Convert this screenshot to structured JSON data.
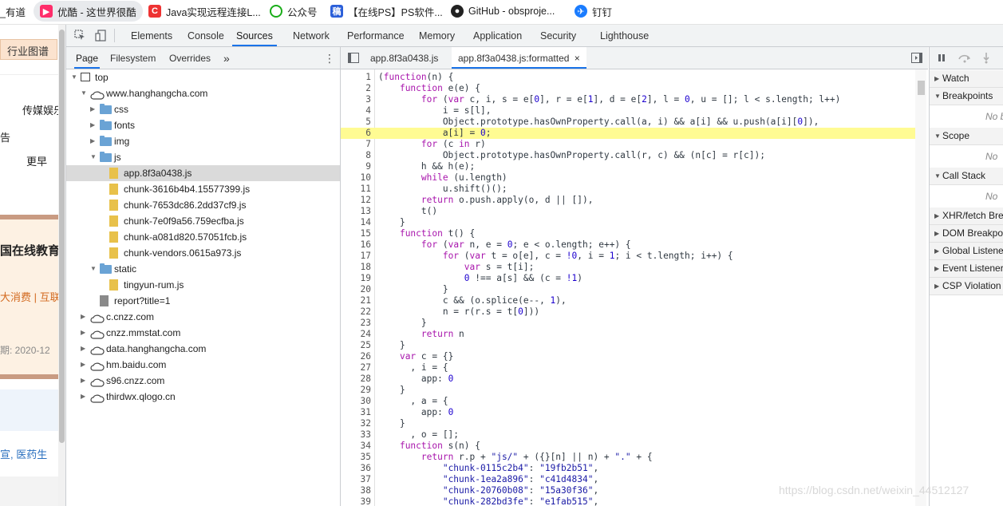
{
  "bookmarks": [
    {
      "label": "_有道",
      "icon": "youdao-icon"
    },
    {
      "label": "优酷 - 这世界很酷",
      "icon": "youku-icon"
    },
    {
      "label": "Java实现远程连接L...",
      "icon": "csdn-icon"
    },
    {
      "label": "公众号",
      "icon": "wechat-icon"
    },
    {
      "label": "【在线PS】PS软件...",
      "icon": "ps-icon"
    },
    {
      "label": "GitHub - obsproje...",
      "icon": "github-icon"
    },
    {
      "label": "钉钉",
      "icon": "dingtalk-icon"
    }
  ],
  "page_fragment": {
    "button": "行业图谱",
    "texts": [
      "传媒娱乐",
      "告",
      "更早",
      "国在线教育",
      "大消费 | 互联",
      "期: 2020-12",
      "宣, 医药生"
    ]
  },
  "devtools": {
    "tabs": [
      "Elements",
      "Console",
      "Sources",
      "Network",
      "Performance",
      "Memory",
      "Application",
      "Security",
      "Lighthouse"
    ],
    "active_tab": "Sources",
    "navigator": {
      "tabs": [
        "Page",
        "Filesystem",
        "Overrides"
      ],
      "more": "»",
      "tree": [
        {
          "label": "top",
          "kind": "frame",
          "level": 0,
          "expanded": true
        },
        {
          "label": "www.hanghangcha.com",
          "kind": "cloud",
          "level": 1,
          "expanded": true
        },
        {
          "label": "css",
          "kind": "folder",
          "level": 2,
          "expanded": false
        },
        {
          "label": "fonts",
          "kind": "folder",
          "level": 2,
          "expanded": false
        },
        {
          "label": "img",
          "kind": "folder",
          "level": 2,
          "expanded": false
        },
        {
          "label": "js",
          "kind": "folder",
          "level": 2,
          "expanded": true
        },
        {
          "label": "app.8f3a0438.js",
          "kind": "file",
          "level": 3,
          "selected": true
        },
        {
          "label": "chunk-3616b4b4.15577399.js",
          "kind": "file",
          "level": 3
        },
        {
          "label": "chunk-7653dc86.2dd37cf9.js",
          "kind": "file",
          "level": 3
        },
        {
          "label": "chunk-7e0f9a56.759ecfba.js",
          "kind": "file",
          "level": 3
        },
        {
          "label": "chunk-a081d820.57051fcb.js",
          "kind": "file",
          "level": 3
        },
        {
          "label": "chunk-vendors.0615a973.js",
          "kind": "file",
          "level": 3
        },
        {
          "label": "static",
          "kind": "folder",
          "level": 2,
          "expanded": true
        },
        {
          "label": "tingyun-rum.js",
          "kind": "file",
          "level": 3
        },
        {
          "label": "report?title=1",
          "kind": "gray-file",
          "level": 2
        },
        {
          "label": "c.cnzz.com",
          "kind": "cloud",
          "level": 1,
          "expanded": false
        },
        {
          "label": "cnzz.mmstat.com",
          "kind": "cloud",
          "level": 1,
          "expanded": false
        },
        {
          "label": "data.hanghangcha.com",
          "kind": "cloud",
          "level": 1,
          "expanded": false
        },
        {
          "label": "hm.baidu.com",
          "kind": "cloud",
          "level": 1,
          "expanded": false
        },
        {
          "label": "s96.cnzz.com",
          "kind": "cloud",
          "level": 1,
          "expanded": false
        },
        {
          "label": "thirdwx.qlogo.cn",
          "kind": "cloud",
          "level": 1,
          "expanded": false
        }
      ]
    },
    "editor": {
      "tabs": [
        {
          "label": "app.8f3a0438.js",
          "active": false
        },
        {
          "label": "app.8f3a0438.js:formatted",
          "active": true,
          "close": "×"
        }
      ],
      "highlight_line": 6,
      "lines": [
        "(function(n) {",
        "    function e(e) {",
        "        for (var c, i, s = e[0], r = e[1], d = e[2], l = 0, u = []; l < s.length; l++)",
        "            i = s[l],",
        "            Object.prototype.hasOwnProperty.call(a, i) && a[i] && u.push(a[i][0]),",
        "            a[i] = 0;",
        "        for (c in r)",
        "            Object.prototype.hasOwnProperty.call(r, c) && (n[c] = r[c]);",
        "        h && h(e);",
        "        while (u.length)",
        "            u.shift()();",
        "        return o.push.apply(o, d || []),",
        "        t()",
        "    }",
        "    function t() {",
        "        for (var n, e = 0; e < o.length; e++) {",
        "            for (var t = o[e], c = !0, i = 1; i < t.length; i++) {",
        "                var s = t[i];",
        "                0 !== a[s] && (c = !1)",
        "            }",
        "            c && (o.splice(e--, 1),",
        "            n = r(r.s = t[0]))",
        "        }",
        "        return n",
        "    }",
        "    var c = {}",
        "      , i = {",
        "        app: 0",
        "    }",
        "      , a = {",
        "        app: 0",
        "    }",
        "      , o = [];",
        "    function s(n) {",
        "        return r.p + \"js/\" + ({}[n] || n) + \".\" + {",
        "            \"chunk-0115c2b4\": \"19fb2b51\",",
        "            \"chunk-1ea2a896\": \"c41d4834\",",
        "            \"chunk-20760b08\": \"15a30f36\",",
        "            \"chunk-282bd3fe\": \"e1fab515\","
      ]
    },
    "debugger": {
      "panes": [
        {
          "title": "Watch",
          "expanded": false
        },
        {
          "title": "Breakpoints",
          "expanded": true,
          "body": "No b"
        },
        {
          "title": "Scope",
          "expanded": true,
          "body": "No"
        },
        {
          "title": "Call Stack",
          "expanded": true,
          "body": "No"
        },
        {
          "title": "XHR/fetch Brea",
          "expanded": false
        },
        {
          "title": "DOM Breakpo",
          "expanded": false
        },
        {
          "title": "Global Listene",
          "expanded": false
        },
        {
          "title": "Event Listener",
          "expanded": false
        },
        {
          "title": "CSP Violation I",
          "expanded": false
        }
      ]
    }
  },
  "watermark": "https://blog.csdn.net/weixin_44512127"
}
